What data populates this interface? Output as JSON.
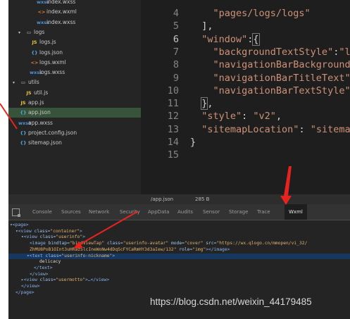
{
  "sidebar": {
    "items": [
      {
        "icon": "wxss",
        "icon_text": "wxss",
        "label": "index.wxss",
        "indent": 40
      },
      {
        "icon": "wxml",
        "icon_text": "<>",
        "label": "index.wxml",
        "indent": 40
      },
      {
        "icon": "wxss",
        "icon_text": "wxss",
        "label": "index.wxss",
        "indent": 40
      },
      {
        "icon": "folder",
        "icon_text": "▭",
        "label": "logs",
        "indent": 14,
        "arrow": "▾"
      },
      {
        "icon": "js",
        "icon_text": "JS",
        "label": "logs.js",
        "indent": 30
      },
      {
        "icon": "json",
        "icon_text": "{}",
        "label": "logs.json",
        "indent": 30
      },
      {
        "icon": "wxml",
        "icon_text": "<>",
        "label": "logs.wxml",
        "indent": 30
      },
      {
        "icon": "wxss",
        "icon_text": "wxss",
        "label": "logs.wxss",
        "indent": 30
      },
      {
        "icon": "folder",
        "icon_text": "▭",
        "label": "utils",
        "indent": 6,
        "arrow": "▾"
      },
      {
        "icon": "js",
        "icon_text": "JS",
        "label": "util.js",
        "indent": 22
      },
      {
        "icon": "js",
        "icon_text": "JS",
        "label": "app.js",
        "indent": 14
      },
      {
        "icon": "json",
        "icon_text": "{}",
        "label": "app.json",
        "indent": 14,
        "selected": true
      },
      {
        "icon": "wxss",
        "icon_text": "wxss",
        "label": "app.wxss",
        "indent": 14
      },
      {
        "icon": "json",
        "icon_text": "{}",
        "label": "project.config.json",
        "indent": 14
      },
      {
        "icon": "json",
        "icon_text": "{}",
        "label": "sitemap.json",
        "indent": 14
      }
    ]
  },
  "editor": {
    "current_line": 6,
    "lines": [
      {
        "n": "4",
        "segs": [
          [
            "str",
            "    \"pages/logs/logs\""
          ]
        ]
      },
      {
        "n": "5",
        "segs": [
          [
            "punc",
            "  ],"
          ]
        ]
      },
      {
        "n": "6",
        "segs": [
          [
            "key2",
            "  \"window\""
          ],
          [
            "punc",
            ":"
          ],
          [
            "brk",
            "{"
          ]
        ]
      },
      {
        "n": "7",
        "segs": [
          [
            "key2",
            "    \"backgroundTextStyle\""
          ],
          [
            "punc",
            ":"
          ],
          [
            "str",
            "\"l"
          ]
        ]
      },
      {
        "n": "8",
        "segs": [
          [
            "key2",
            "    \"navigationBarBackgroundC"
          ]
        ]
      },
      {
        "n": "9",
        "segs": [
          [
            "key2",
            "    \"navigationBarTitleText\""
          ],
          [
            "punc",
            ":"
          ]
        ]
      },
      {
        "n": "10",
        "segs": [
          [
            "key2",
            "    \"navigationBarTextStyle\""
          ],
          [
            "punc",
            ":"
          ]
        ]
      },
      {
        "n": "11",
        "segs": [
          [
            "punc",
            "  "
          ],
          [
            "brk",
            "}"
          ],
          [
            "punc",
            ","
          ]
        ]
      },
      {
        "n": "12",
        "segs": [
          [
            "key2",
            "  \"style\""
          ],
          [
            "punc",
            ": "
          ],
          [
            "str",
            "\"v2\""
          ],
          [
            "punc",
            ","
          ]
        ]
      },
      {
        "n": "13",
        "segs": [
          [
            "key2",
            "  \"sitemapLocation\""
          ],
          [
            "punc",
            ": "
          ],
          [
            "str",
            "\"sitemap"
          ]
        ]
      },
      {
        "n": "14",
        "segs": [
          [
            "punc",
            "}"
          ]
        ]
      },
      {
        "n": "15",
        "segs": []
      }
    ]
  },
  "status_bar": {
    "path": "/app.json",
    "size": "285 B"
  },
  "devtools": {
    "tabs": [
      "Console",
      "Sources",
      "Network",
      "Security",
      "AppData",
      "Audits",
      "Sensor",
      "Storage",
      "Trace",
      "Wxml"
    ],
    "active_tab": "Wxml",
    "dom": [
      {
        "indent": 2,
        "segs": [
          [
            "tag",
            "▾<page>"
          ]
        ]
      },
      {
        "indent": 10,
        "segs": [
          [
            "tag",
            "▾<view "
          ],
          [
            "attr",
            "class="
          ],
          [
            "val",
            "\"container\""
          ],
          [
            "tag",
            ">"
          ]
        ]
      },
      {
        "indent": 18,
        "segs": [
          [
            "tag",
            "▾<view "
          ],
          [
            "attr",
            "class="
          ],
          [
            "val",
            "\"userinfo\""
          ],
          [
            "tag",
            ">"
          ]
        ]
      },
      {
        "indent": 30,
        "segs": [
          [
            "tag",
            "<image "
          ],
          [
            "attr",
            "bindtap="
          ],
          [
            "val",
            "\"bindViewTap\" "
          ],
          [
            "attr",
            "class="
          ],
          [
            "val",
            "\"userinfo-avatar\" "
          ],
          [
            "attr",
            "mode="
          ],
          [
            "val",
            "\"cover\" "
          ],
          [
            "attr",
            "src="
          ],
          [
            "val",
            "\"https://wx.qlogo.cn/mmopen/vi_32/"
          ]
        ]
      },
      {
        "indent": 30,
        "segs": [
          [
            "val",
            "ZhMU8PoB1OInt3uHRaz5lcIneWoNw4dDqScFYCaRmHY3d3aIew/132\" "
          ],
          [
            "attr",
            "role="
          ],
          [
            "val",
            "\"img\""
          ],
          [
            "tag",
            "></image>"
          ]
        ]
      },
      {
        "indent": 26,
        "sel": true,
        "segs": [
          [
            "tag",
            "▾<text "
          ],
          [
            "attr",
            "class="
          ],
          [
            "val",
            "\"userinfo-nickname\""
          ],
          [
            "tag",
            ">"
          ]
        ]
      },
      {
        "indent": 44,
        "segs": [
          [
            "txt",
            "delicacy"
          ]
        ]
      },
      {
        "indent": 36,
        "segs": [
          [
            "tag",
            "</text>"
          ]
        ]
      },
      {
        "indent": 30,
        "segs": [
          [
            "tag",
            "</view>"
          ]
        ]
      },
      {
        "indent": 18,
        "segs": [
          [
            "tag",
            "▸<view "
          ],
          [
            "attr",
            "class="
          ],
          [
            "val",
            "\"usermotto\""
          ],
          [
            "tag",
            ">…</view>"
          ]
        ]
      },
      {
        "indent": 18,
        "segs": [
          [
            "tag",
            "</view>"
          ]
        ]
      },
      {
        "indent": 10,
        "segs": [
          [
            "tag",
            "</page>"
          ]
        ]
      }
    ]
  },
  "watermark": "https://blog.csdn.net/weixin_44179485",
  "colors": {
    "annotation": "#e8231f",
    "selection": "#17375e",
    "file_selected": "#37543a"
  }
}
